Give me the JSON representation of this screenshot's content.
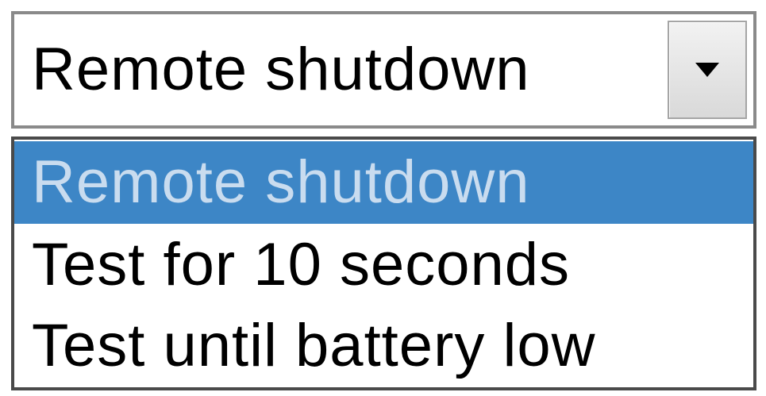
{
  "select": {
    "value": "Remote shutdown",
    "arrow_icon": "dropdown-arrow-icon"
  },
  "dropdown": {
    "options": [
      {
        "label": "Remote shutdown",
        "selected": true
      },
      {
        "label": "Test for 10 seconds",
        "selected": false
      },
      {
        "label": "Test until battery low",
        "selected": false
      }
    ]
  },
  "colors": {
    "selected_bg": "#3d86c6",
    "selected_text": "#c9dcef",
    "text": "#000000",
    "border": "#8a8a8a"
  }
}
